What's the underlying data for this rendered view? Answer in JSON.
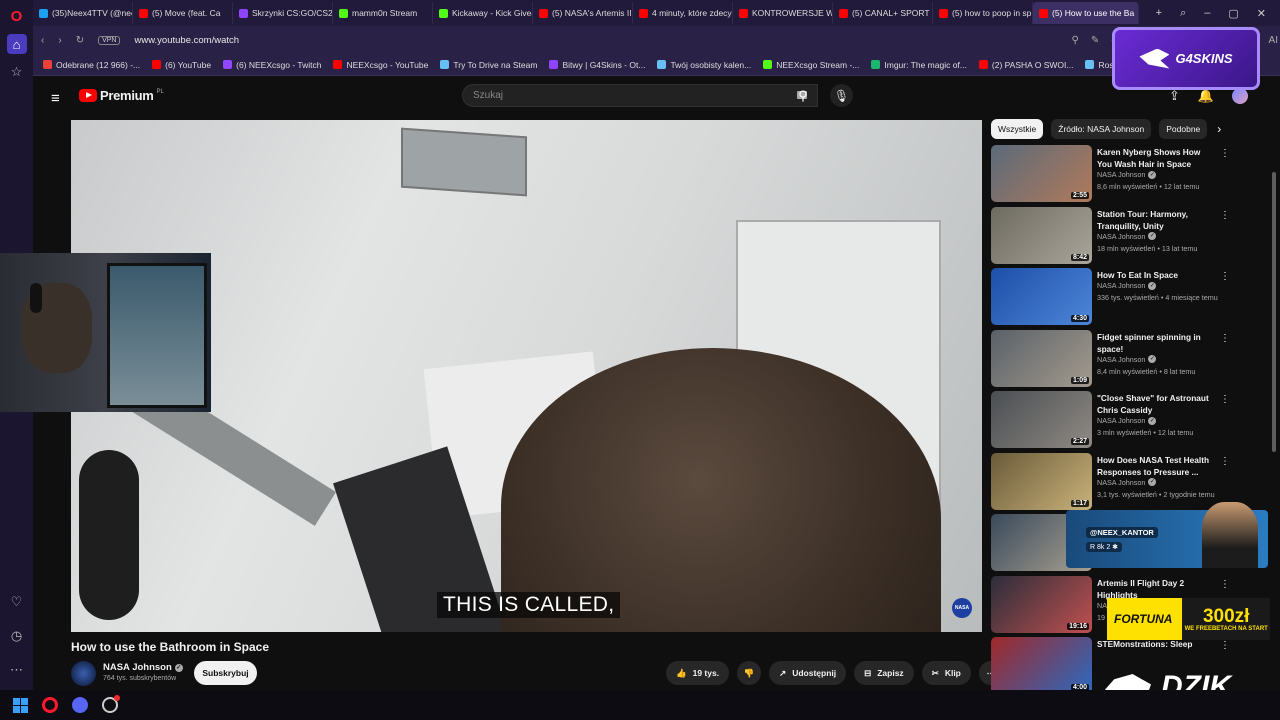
{
  "browser": {
    "tabs": [
      {
        "label": "(35)Neex4TTV (@nee",
        "color": "#1da1f2"
      },
      {
        "label": "(5) Move (feat. Ca",
        "color": "#ff0000"
      },
      {
        "label": "Skrzynki CS:GO/CS2 |",
        "color": "#8e44ff"
      },
      {
        "label": "mamm0n Stream",
        "color": "#53fc18"
      },
      {
        "label": "Kickaway - Kick Givea",
        "color": "#53fc18"
      },
      {
        "label": "(5) NASA's Artemis II",
        "color": "#ff0000"
      },
      {
        "label": "4 minuty, które zdecy",
        "color": "#ff0000"
      },
      {
        "label": "KONTROWERSJE W K",
        "color": "#ff0000"
      },
      {
        "label": "(5) CANAL+ SPORT -",
        "color": "#ff0000"
      },
      {
        "label": "(5) how to poop in sp",
        "color": "#ff0000"
      },
      {
        "label": "(5) How to use the Ba",
        "color": "#ff0000",
        "active": true
      }
    ],
    "url": "www.youtube.com/watch",
    "vpn": "VPN",
    "bookmarks": [
      {
        "label": "Odebrane (12 966) -...",
        "color": "#ea4335"
      },
      {
        "label": "(6) YouTube",
        "color": "#ff0000"
      },
      {
        "label": "(6) NEEXcsgo - Twitch",
        "color": "#9146ff"
      },
      {
        "label": "NEEXcsgo - YouTube",
        "color": "#ff0000"
      },
      {
        "label": "Try To Drive na Steam",
        "color": "#66c0f4"
      },
      {
        "label": "Bitwy | G4Skins - Ot...",
        "color": "#8e44ff"
      },
      {
        "label": "Twój osobisty kalen...",
        "color": "#66c0f4"
      },
      {
        "label": "NEEXcsgo Stream -...",
        "color": "#53fc18"
      },
      {
        "label": "Imgur: The magic of...",
        "color": "#1bb76e"
      },
      {
        "label": "(2) PASHA O SWOI...",
        "color": "#ff0000"
      },
      {
        "label": "Rosalie na Steam",
        "color": "#66c0f4"
      }
    ],
    "ai_label": "AI"
  },
  "youtube": {
    "logo_text": "Premium",
    "region": "PL",
    "search_placeholder": "Szukaj",
    "notif_count": "9+",
    "video": {
      "caption": "THIS IS CALLED,",
      "watermark": "NASA",
      "title": "How to use the Bathroom in Space",
      "channel": "NASA Johnson",
      "subscribers": "764 tys. subskrybentów",
      "subscribe_label": "Subskrybuj",
      "likes": "19 tys.",
      "share_label": "Udostępnij",
      "save_label": "Zapisz",
      "clip_label": "Klip",
      "more": "⋯"
    },
    "chips": [
      "Wszystkie",
      "Źródło: NASA Johnson",
      "Podobne"
    ],
    "related": [
      {
        "title": "Karen Nyberg Shows How You Wash Hair in Space",
        "channel": "NASA Johnson",
        "meta": "8,6 mln wyświetleń • 12 lat temu",
        "duration": "2:55",
        "c1": "#5b6a7a",
        "c2": "#b07a5a"
      },
      {
        "title": "Station Tour: Harmony, Tranquility, Unity",
        "channel": "NASA Johnson",
        "meta": "18 mln wyświetleń • 13 lat temu",
        "duration": "8:42",
        "c1": "#6d6a60",
        "c2": "#aaa59a"
      },
      {
        "title": "How To Eat In Space",
        "channel": "NASA Johnson",
        "meta": "336 tys. wyświetleń • 4 miesiące temu",
        "duration": "4:30",
        "c1": "#1d4fa8",
        "c2": "#4d86d8"
      },
      {
        "title": "Fidget spinner spinning in space!",
        "channel": "NASA Johnson",
        "meta": "8,4 mln wyświetleń • 8 lat temu",
        "duration": "1:09",
        "c1": "#5a6168",
        "c2": "#a39a8e"
      },
      {
        "title": "\"Close Shave\" for Astronaut Chris Cassidy",
        "channel": "NASA Johnson",
        "meta": "3 mln wyświetleń • 12 lat temu",
        "duration": "2:27",
        "c1": "#4a4e52",
        "c2": "#8f8a84"
      },
      {
        "title": "How Does NASA Test Health Responses to Pressure ...",
        "channel": "NASA Johnson",
        "meta": "3,1 tys. wyświetleń • 2 tygodnie temu",
        "duration": "1:17",
        "c1": "#6a5b3a",
        "c2": "#c9b27a"
      },
      {
        "title": "",
        "channel": "",
        "meta": "",
        "duration": "",
        "c1": "#3a4a5a",
        "c2": "#a8a090"
      },
      {
        "title": "Artemis II Flight Day 2 Highlights",
        "channel": "NA",
        "meta": "19",
        "duration": "19:16",
        "c1": "#2a2e3a",
        "c2": "#c05050"
      },
      {
        "title": "STEMonstrations: Sleep",
        "channel": "",
        "meta": "",
        "duration": "4:00",
        "c1": "#a02828",
        "c2": "#2a6ac2"
      }
    ]
  },
  "overlays": {
    "g4skins": "G4SKINS",
    "neex_handle": "@NEEX_KANTOR",
    "neex_socials": "R  8k  2  ✱",
    "fortuna_brand": "FORTUNA",
    "fortuna_amount": "300zł",
    "fortuna_sub": "WE FREEBETACH NA START",
    "dzik": "DZIK"
  }
}
